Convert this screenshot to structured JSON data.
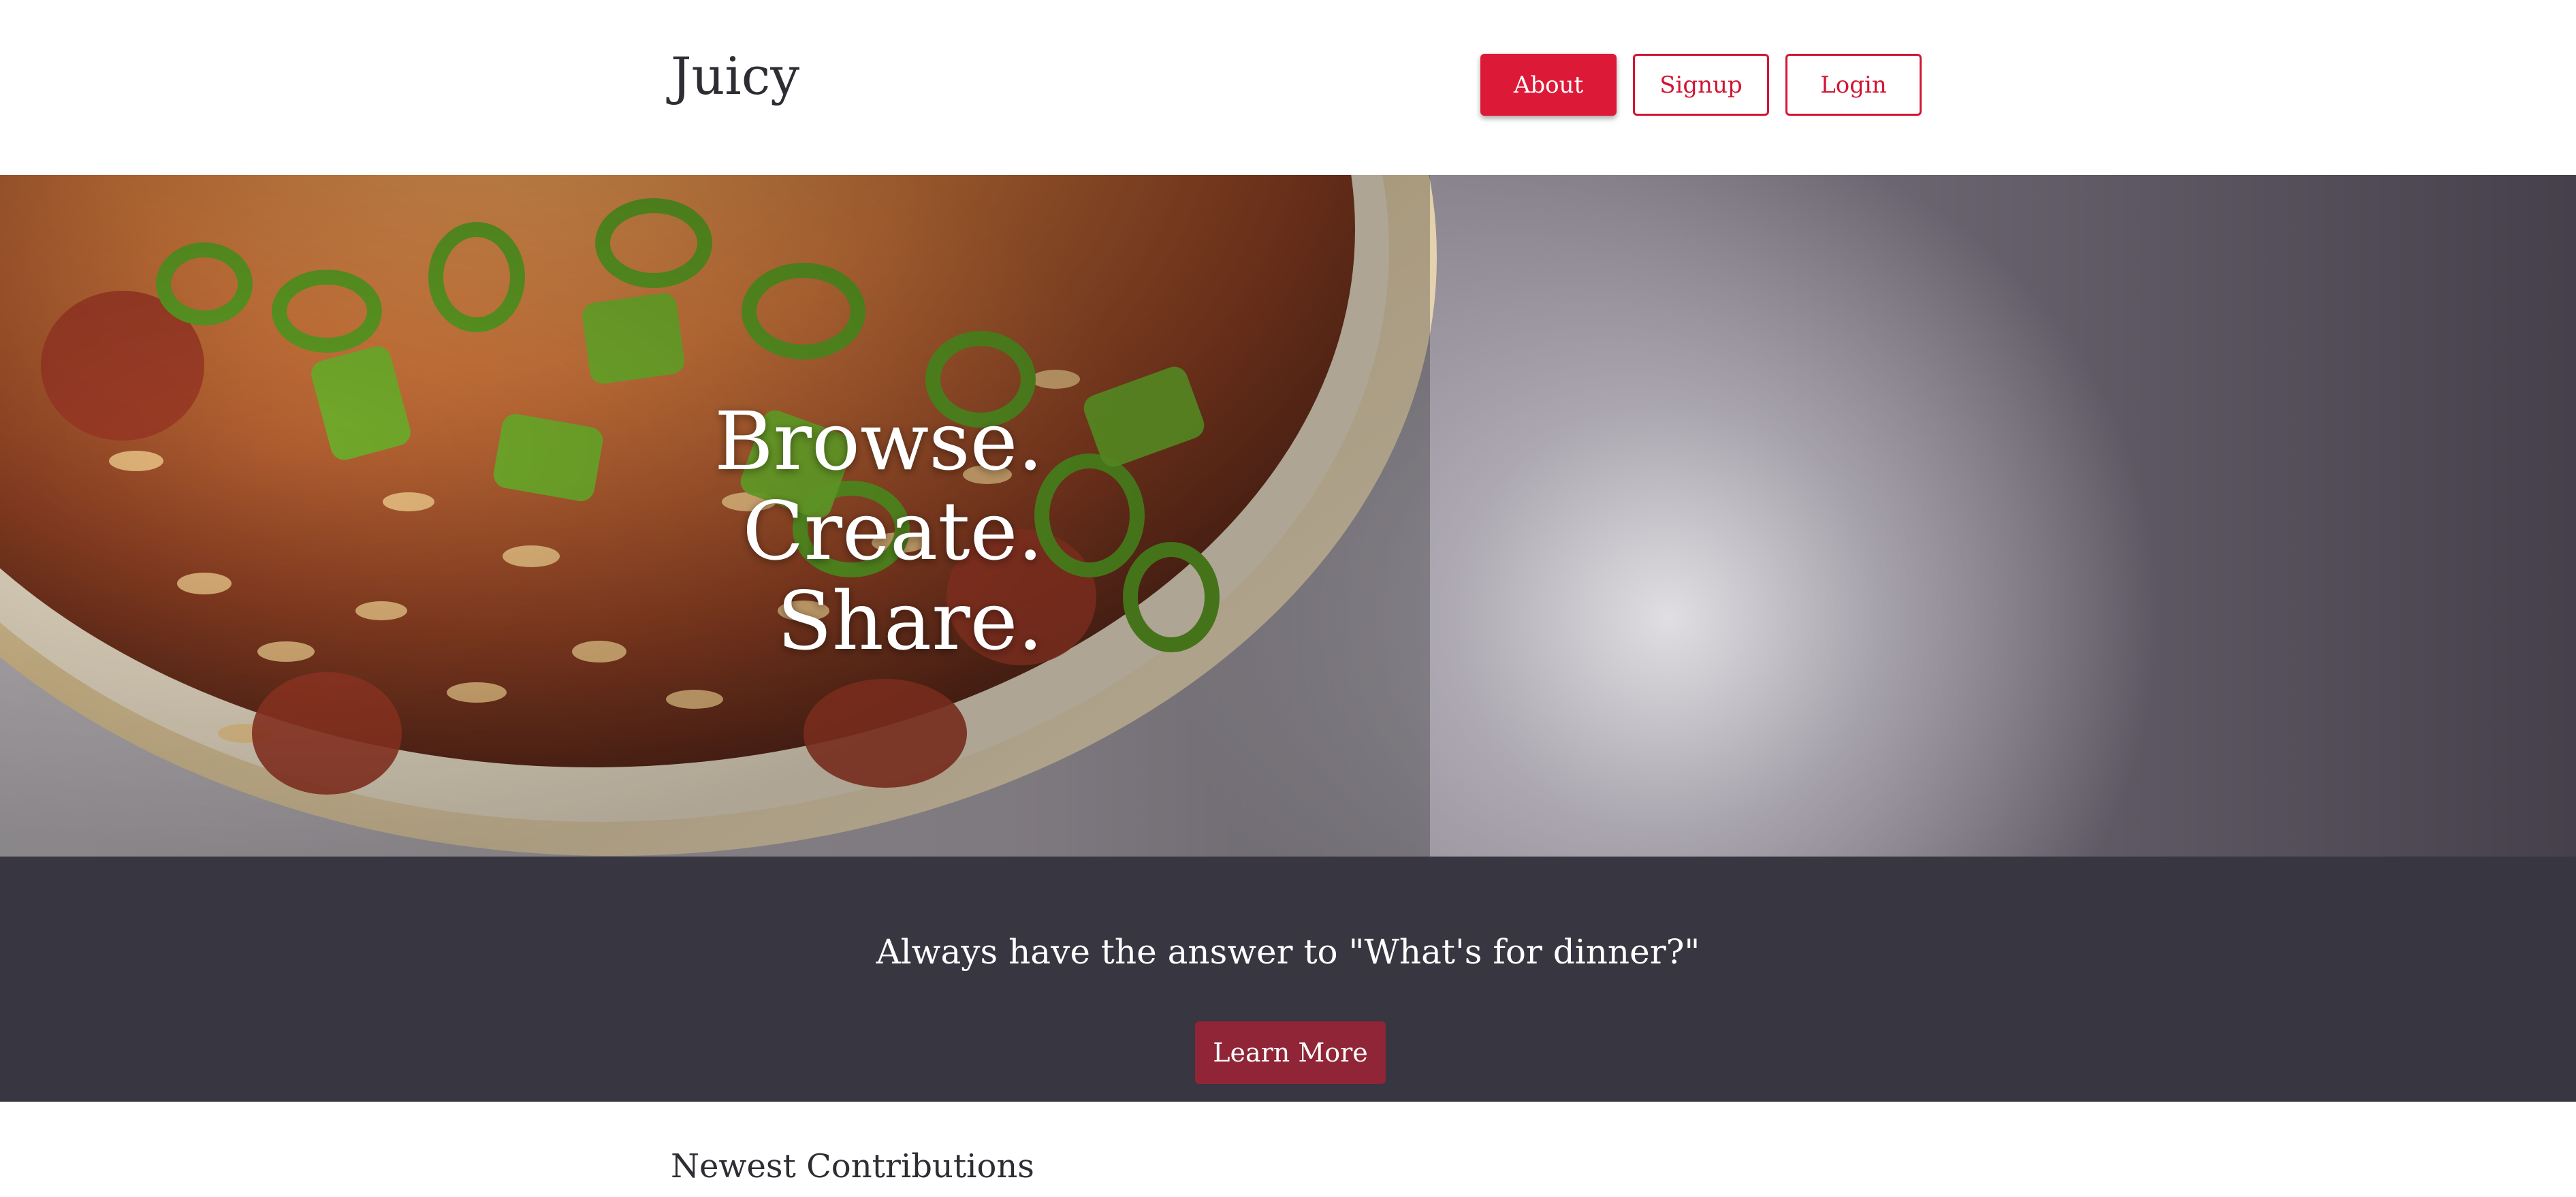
{
  "header": {
    "brand": "Juicy",
    "nav": {
      "about": "About",
      "signup": "Signup",
      "login": "Login"
    }
  },
  "hero": {
    "lines": [
      "Browse.",
      "Create.",
      "Share."
    ],
    "image": "food-bowl-photo"
  },
  "band": {
    "tagline": "Always have the answer to \"What's for dinner?\"",
    "cta": "Learn More"
  },
  "newest": {
    "title": "Newest Contributions"
  },
  "colors": {
    "accent": "#dc1a38",
    "band": "#373641",
    "cta": "#8f2536"
  }
}
